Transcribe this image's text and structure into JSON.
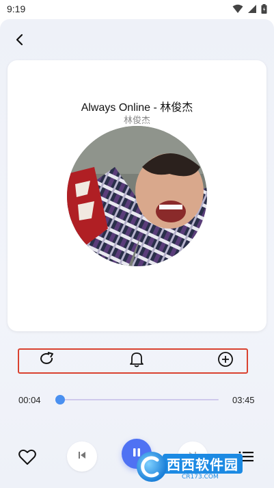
{
  "status_bar": {
    "time": "9:19"
  },
  "song": {
    "title": "Always Online - 林俊杰",
    "artist": "林俊杰"
  },
  "player": {
    "current_time": "00:04",
    "total_time": "03:45",
    "progress_fraction": 0.018
  },
  "icons": {
    "back": "chevron-left-icon",
    "repeat": "repeat-icon",
    "alarm": "bell-icon",
    "add": "plus-circle-icon",
    "favorite": "heart-icon",
    "previous": "skip-previous-icon",
    "play_pause": "pause-icon",
    "next": "skip-next-icon",
    "playlist": "playlist-icon"
  },
  "colors": {
    "accent": "#4f72f3",
    "highlight_border": "#d9412f",
    "progress_track": "#cfc9ec"
  },
  "watermark": {
    "brand": "西西软件园",
    "url": "CR173.COM"
  }
}
